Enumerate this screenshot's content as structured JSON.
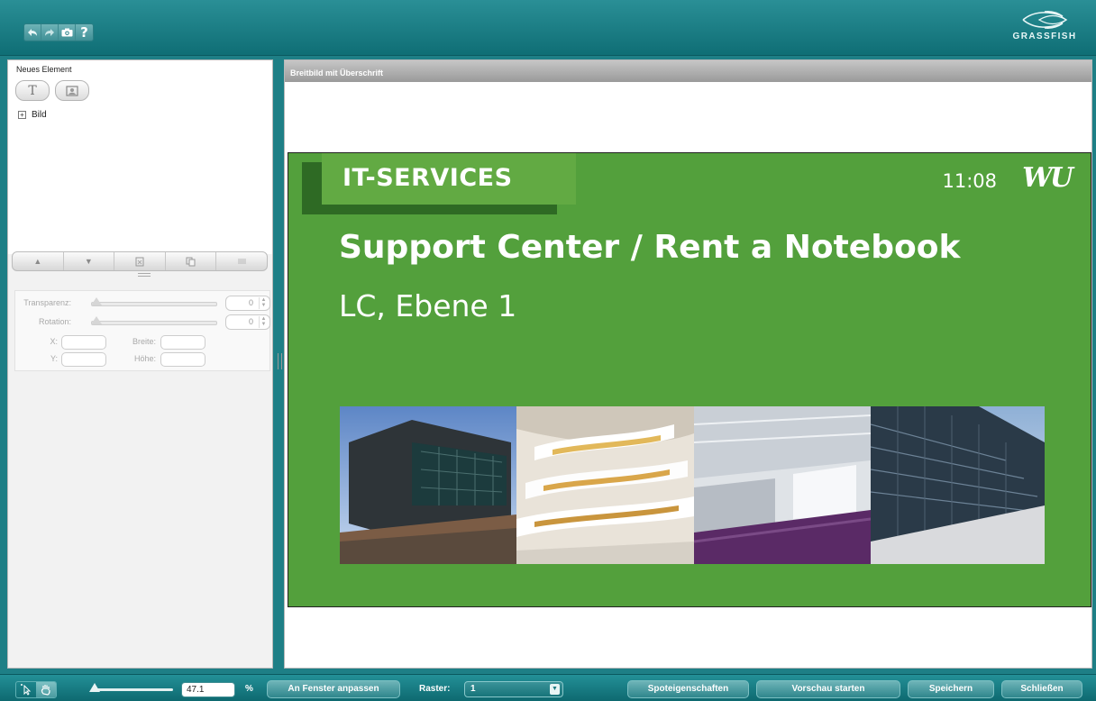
{
  "topbar": {
    "brand": "GRASSFISH",
    "buttons": [
      "undo-icon",
      "redo-icon",
      "camera-icon",
      "help-icon"
    ],
    "help_label": "?"
  },
  "left_panel": {
    "new_element_title": "Neues Element",
    "new_buttons": [
      {
        "icon": "text-element-icon",
        "glyph": "T"
      },
      {
        "icon": "image-element-icon"
      }
    ],
    "tree": [
      {
        "label": "Bild",
        "expander": "+"
      }
    ],
    "order_buttons": [
      "move-up-icon",
      "move-down-icon",
      "bring-front-icon",
      "copy-icon",
      "list-icon"
    ],
    "properties": {
      "transparency_label": "Transparenz:",
      "transparency_value": "0",
      "rotation_label": "Rotation:",
      "rotation_value": "0",
      "x_label": "X:",
      "y_label": "Y:",
      "width_label": "Breite:",
      "height_label": "Höhe:"
    }
  },
  "main": {
    "header": "Breitbild mit Überschrift",
    "slide": {
      "tab_text": "IT-SERVICES",
      "time": "11:08",
      "logo": "WU",
      "title": "Support Center / Rent a Notebook",
      "subtitle": "LC, Ebene 1",
      "background_color": "#53a03c",
      "photos": [
        "building-exterior-photo",
        "atrium-interior-photo",
        "hall-interior-photo",
        "facade-photo"
      ]
    }
  },
  "bottombar": {
    "tools": [
      "select-tool-icon",
      "hand-tool-icon"
    ],
    "zoom_value": "47.1",
    "zoom_unit": "%",
    "fit_button": "An Fenster anpassen",
    "raster_label": "Raster:",
    "raster_value": "1",
    "spot_props_button": "Spoteigenschaften",
    "preview_button": "Vorschau starten",
    "save_button": "Speichern",
    "close_button": "Schließen"
  },
  "colors": {
    "accent": "#0f6e75",
    "slide_green": "#53a03c",
    "slide_tab_green": "#62aa43",
    "slide_dark_green": "#2e6a24"
  }
}
